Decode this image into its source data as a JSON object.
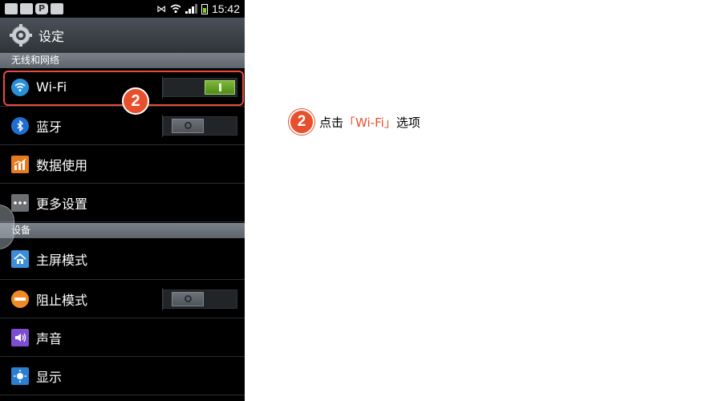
{
  "status_bar": {
    "time": "15:42",
    "left_icons": [
      "phone-icon",
      "image-icon",
      "p-icon",
      "sim-icon"
    ],
    "p_icon_label": "P"
  },
  "header": {
    "title": "设定",
    "icon": "gear-icon"
  },
  "sections": [
    {
      "label": "无线和网络"
    },
    {
      "label": "设备"
    }
  ],
  "rows": [
    {
      "label": "Wi-Fi",
      "icon": "wifi-icon",
      "icon_color": "#2a8fd8",
      "toggle": "on"
    },
    {
      "label": "蓝牙",
      "icon": "bluetooth-icon",
      "icon_color": "#1f6fd1",
      "toggle": "off"
    },
    {
      "label": "数据使用",
      "icon": "data-usage-icon",
      "icon_color": "#e87a1e"
    },
    {
      "label": "更多设置",
      "icon": "more-icon",
      "icon_color": "#6d6f72"
    },
    {
      "label": "主屏模式",
      "icon": "home-icon",
      "icon_color": "#3a8fd8"
    },
    {
      "label": "阻止模式",
      "icon": "block-icon",
      "icon_color": "#f08a24",
      "toggle": "off"
    },
    {
      "label": "声音",
      "icon": "sound-icon",
      "icon_color": "#7b4fd0"
    },
    {
      "label": "显示",
      "icon": "display-icon",
      "icon_color": "#2a7fd0"
    }
  ],
  "badges": {
    "step_number": "2"
  },
  "instruction": {
    "step": "2",
    "prefix": "点击",
    "quoted": "「Wi-Fi」",
    "suffix": "选项"
  },
  "colors": {
    "highlight": "#e84b3c",
    "badge": "#e8502d",
    "toggle_on": "#6aab2e"
  }
}
